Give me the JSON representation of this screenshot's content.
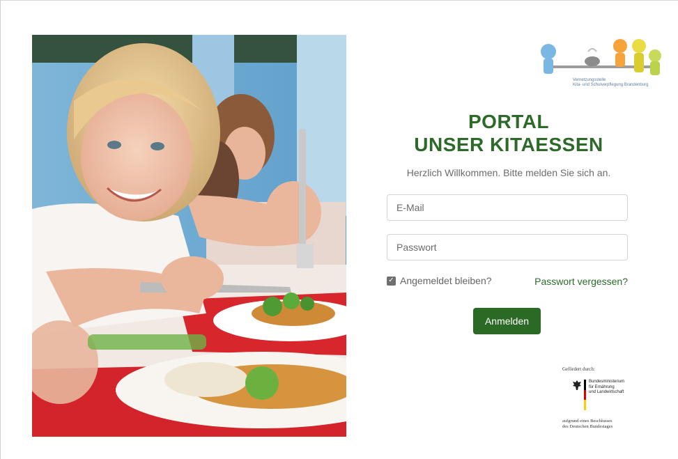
{
  "logo": {
    "caption_line1": "Vernetzungsstelle",
    "caption_line2": "Kita- und Schulverpflegung Brandenburg"
  },
  "portal": {
    "title_line1": "PORTAL",
    "title_line2": "UNSER KITAESSEN",
    "subtitle": "Herzlich Willkommen. Bitte melden Sie sich an."
  },
  "form": {
    "email_placeholder": "E-Mail",
    "password_placeholder": "Passwort",
    "remember_label": "Angemeldet bleiben?",
    "remember_checked": true,
    "forgot_label": "Passwort vergessen?",
    "submit_label": "Anmelden"
  },
  "funding": {
    "label": "Gefördert durch:",
    "ministry_line1": "Bundesministerium",
    "ministry_line2": "für Ernährung",
    "ministry_line3": "und Landwirtschaft",
    "resolution_line1": "aufgrund eines Beschlusses",
    "resolution_line2": "des Deutschen Bundestages"
  },
  "colors": {
    "brand_green": "#2b6a25",
    "title_green": "#2d6a2a",
    "text_gray": "#6c6c6c"
  },
  "icons": {
    "photo": "child-eating-lunch-photo",
    "logo": "children-table-logo",
    "eagle": "federal-eagle-icon",
    "checkbox": "checkbox-checked-icon"
  }
}
